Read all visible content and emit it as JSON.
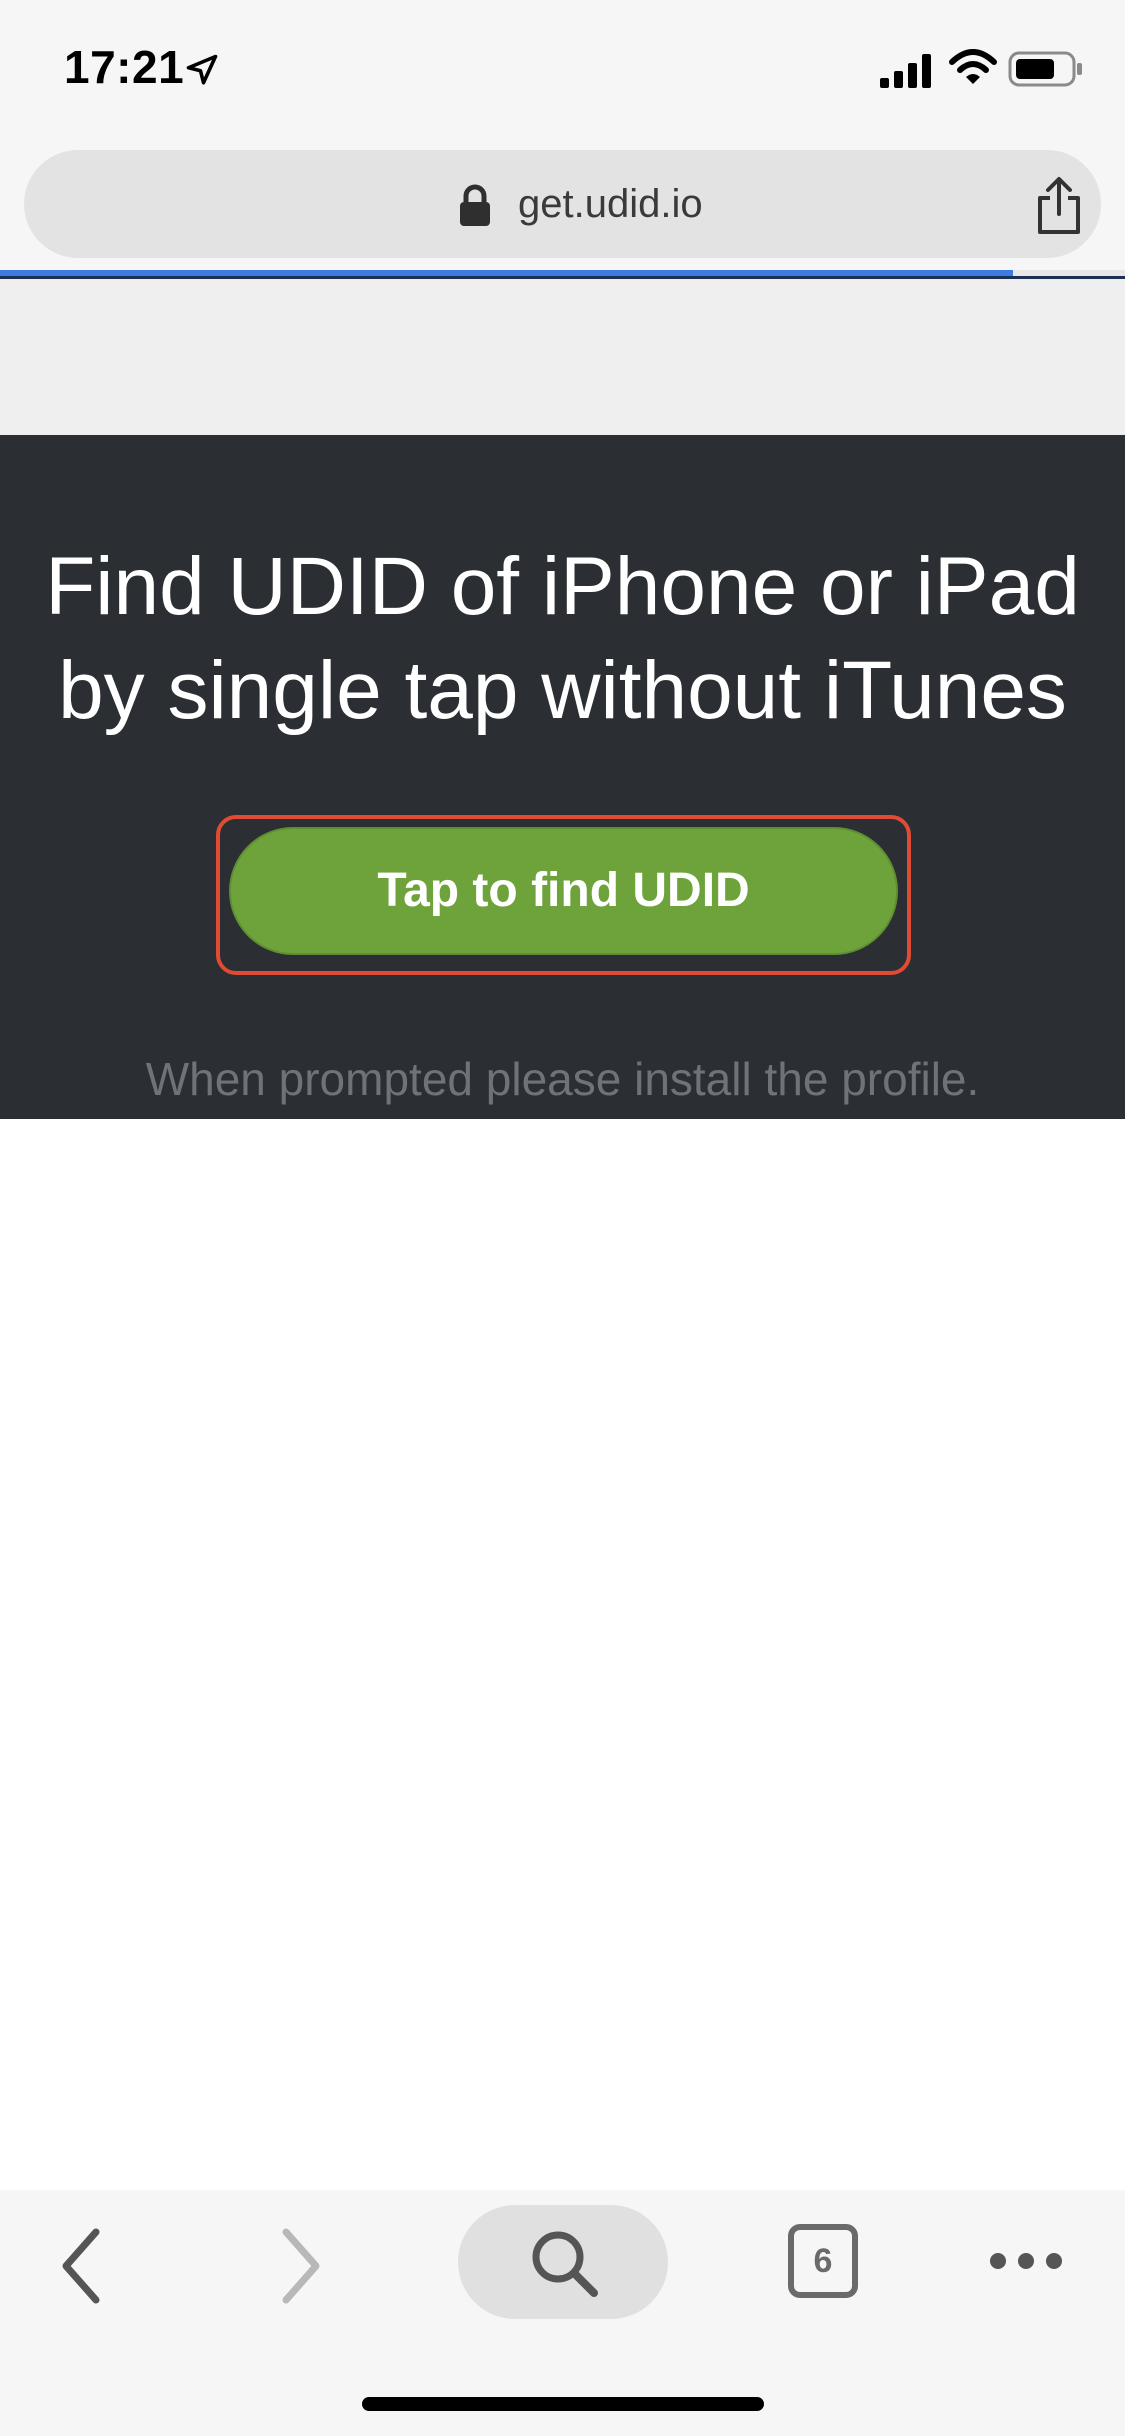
{
  "status_bar": {
    "time": "17:21",
    "icons": [
      "location-arrow-icon",
      "signal-icon",
      "wifi-icon",
      "battery-icon"
    ]
  },
  "address_bar": {
    "url": "get.udid.io",
    "lock_icon": "lock-icon",
    "share_icon": "share-icon"
  },
  "progress": {
    "fraction": 0.9
  },
  "hero": {
    "title_line1": "Find UDID of iPhone or iPad",
    "title_line2": "by single tap without iTunes",
    "cta_label": "Tap to find UDID",
    "note": "When prompted please install the profile."
  },
  "toolbar": {
    "back_icon": "chevron-left-icon",
    "forward_icon": "chevron-right-icon",
    "search_icon": "search-icon",
    "tabs_count": "6",
    "more_icon": "more-icon"
  },
  "colors": {
    "hero_bg": "#2b2e33",
    "cta_green": "#6ea33b",
    "highlight_red": "#e04b33",
    "progress_blue": "#3d7be0"
  }
}
